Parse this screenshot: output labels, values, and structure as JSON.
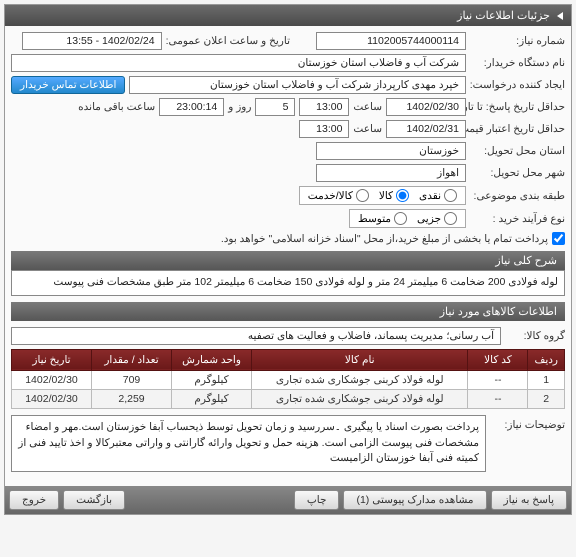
{
  "header": "جزئیات اطلاعات نیاز",
  "fields": {
    "need_no_lbl": "شماره نیاز:",
    "need_no": "1102005744000114",
    "announce_lbl": "تاریخ و ساعت اعلان عمومی:",
    "announce": "1402/02/24 - 13:55",
    "buyer_lbl": "نام دستگاه خریدار:",
    "buyer": "شرکت آب و فاضلاب استان خوزستان",
    "creator_lbl": "ایجاد کننده درخواست:",
    "creator": "خپرد مهدی کارپرداز شرکت آب و فاضلاب استان خوزستان",
    "contact_btn": "اطلاعات تماس خریدار",
    "deadline_lbl": "حداقل تاریخ پاسخ: تا تاریخ:",
    "deadline_date": "1402/02/30",
    "deadline_time_lbl": "ساعت",
    "deadline_time": "13:00",
    "days": "5",
    "days_lbl": "روز و",
    "remain": "23:00:14",
    "remain_lbl": "ساعت باقی مانده",
    "validity_lbl": "حداقل تاریخ اعتبار قیمت: تا تاریخ:",
    "validity_date": "1402/02/31",
    "validity_time": "13:00",
    "province_lbl": "استان محل تحویل:",
    "province": "خوزستان",
    "city_lbl": "شهر محل تحویل:",
    "city": "اهواز",
    "pay_class_lbl": "طبقه بندی موضوعی:",
    "pay_class_items": [
      "نقدی",
      "کالا",
      "کالا/خدمت"
    ],
    "buy_proc_lbl": "نوع فرآیند خرید :",
    "buy_proc_items": [
      "جزیی",
      "متوسط"
    ],
    "pay_note": "پرداخت تمام یا بخشی از مبلغ خرید،از محل \"اسناد خزانه اسلامی\" خواهد بود."
  },
  "sec_summary": "شرح کلی نیاز",
  "summary_text": "لوله فولادی 200 ضخامت 6 میلیمتر 24 متر و لوله فولادی 150 ضخامت 6 میلیمتر 102 متر طبق مشخصات فنی پیوست",
  "sec_items": "اطلاعات کالاهای مورد نیاز",
  "group_lbl": "گروه کالا:",
  "group_val": "آب رسانی؛ مدیریت پسماند، فاضلاب و فعالیت های تصفیه",
  "table": {
    "headers": [
      "ردیف",
      "کد کالا",
      "نام کالا",
      "واحد شمارش",
      "تعداد / مقدار",
      "تاریخ نیاز"
    ],
    "rows": [
      [
        "1",
        "--",
        "لوله فولاد کربنی جوشکاری شده تجاری",
        "کیلوگرم",
        "709",
        "1402/02/30"
      ],
      [
        "2",
        "--",
        "لوله فولاد کربنی جوشکاری شده تجاری",
        "کیلوگرم",
        "2,259",
        "1402/02/30"
      ]
    ]
  },
  "notes_lbl": "توضیحات نیاز:",
  "notes_text": "پرداخت بصورت اسناد یا پیگیری ۔سررسید و زمان تحویل توسط ذیحساب آبفا خوزستان است.مهر و امضاء مشخصات فنی پیوست الزامی است. هزینه حمل و تحویل وارائه گارانتی و واراتی معتبرکالا و اخذ تایید فنی از کمیته فنی آبفا خوزستان الزامیست",
  "footer": {
    "reply": "پاسخ به نیاز",
    "attach": "مشاهده مدارک پیوستی (1)",
    "print": "چاپ",
    "back": "بازگشت",
    "exit": "خروج"
  }
}
